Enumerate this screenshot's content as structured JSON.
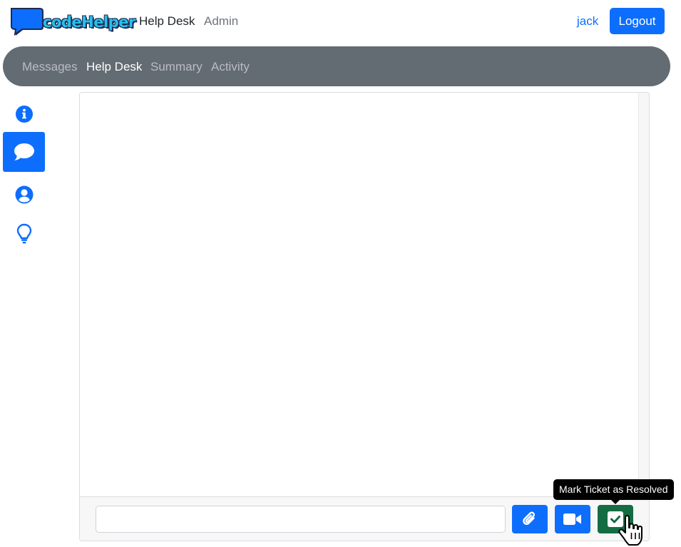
{
  "header": {
    "logo_text": "codeHelper",
    "nav": [
      {
        "label": "Help Desk",
        "active": true
      },
      {
        "label": "Admin",
        "active": false
      }
    ],
    "username": "jack",
    "logout_label": "Logout"
  },
  "subnav": {
    "items": [
      {
        "label": "Messages",
        "active": false
      },
      {
        "label": "Help Desk",
        "active": true
      },
      {
        "label": "Summary",
        "active": false
      },
      {
        "label": "Activity",
        "active": false
      }
    ]
  },
  "sidebar": {
    "items": [
      {
        "icon": "info-circle-icon",
        "active": false
      },
      {
        "icon": "chat-bubble-icon",
        "active": true
      },
      {
        "icon": "user-circle-icon",
        "active": false
      },
      {
        "icon": "lightbulb-icon",
        "active": false
      }
    ]
  },
  "chat": {
    "input_value": "",
    "input_placeholder": "",
    "actions": [
      {
        "icon": "paperclip-icon",
        "color": "#0d6efd"
      },
      {
        "icon": "video-camera-icon",
        "color": "#0d6efd"
      },
      {
        "icon": "check-square-icon",
        "color": "#146c43"
      }
    ],
    "tooltip": "Mark Ticket as Resolved"
  },
  "colors": {
    "primary": "#0d6efd",
    "subnav_bg": "#636c73",
    "resolve_green": "#146c43"
  }
}
